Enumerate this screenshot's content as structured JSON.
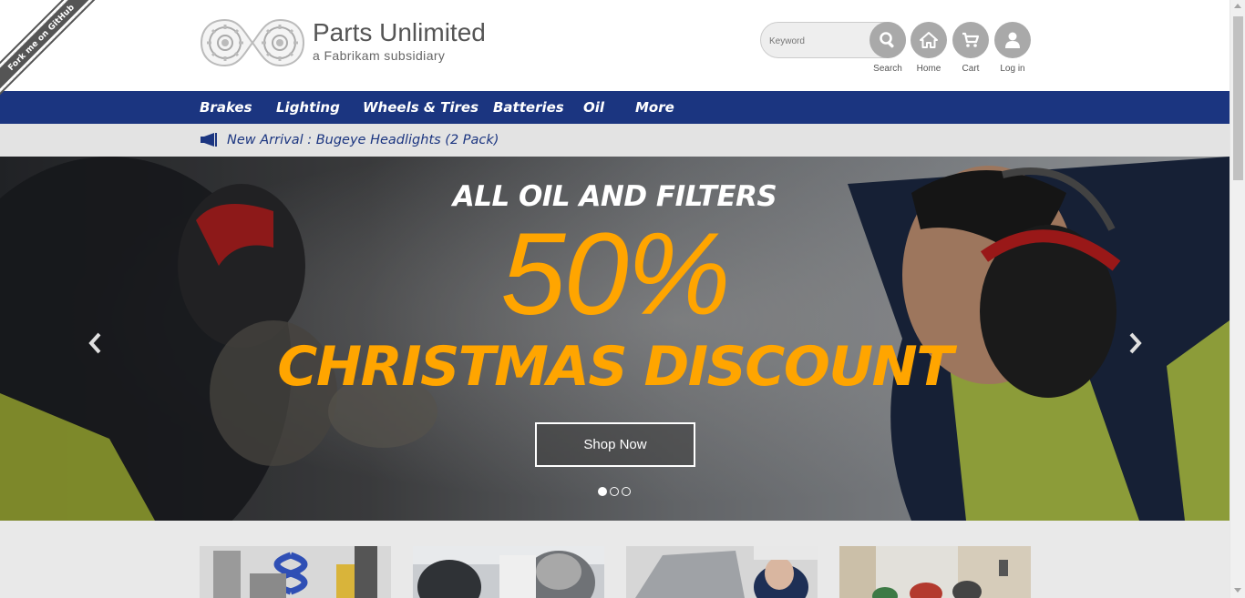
{
  "ribbon": {
    "label": "Fork me on GitHub"
  },
  "brand": {
    "title": "Parts Unlimited",
    "subtitle": "a Fabrikam subsidiary"
  },
  "search": {
    "placeholder": "Keyword",
    "label": "Search"
  },
  "header_actions": {
    "home": "Home",
    "cart": "Cart",
    "login": "Log in"
  },
  "nav": {
    "items": [
      "Brakes",
      "Lighting",
      "Wheels & Tires",
      "Batteries",
      "Oil",
      "More"
    ]
  },
  "announcement": {
    "text": "New Arrival : Bugeye Headlights (2 Pack)"
  },
  "hero": {
    "headline": "ALL OIL AND FILTERS",
    "percent": "50%",
    "discount": "CHRISTMAS DISCOUNT",
    "cta": "Shop Now",
    "prev_arrow": "‹",
    "next_arrow": "›",
    "slide_count": 3,
    "active_slide": 1
  },
  "colors": {
    "nav": "#1b3580",
    "accent": "#ffa500",
    "announce_bg": "#e3e3e3",
    "icon_gray": "#a9a9a9"
  },
  "icons": [
    "gears-logo",
    "search-icon",
    "home-icon",
    "cart-icon",
    "user-icon",
    "megaphone-icon",
    "chevron-left-icon",
    "chevron-right-icon"
  ]
}
